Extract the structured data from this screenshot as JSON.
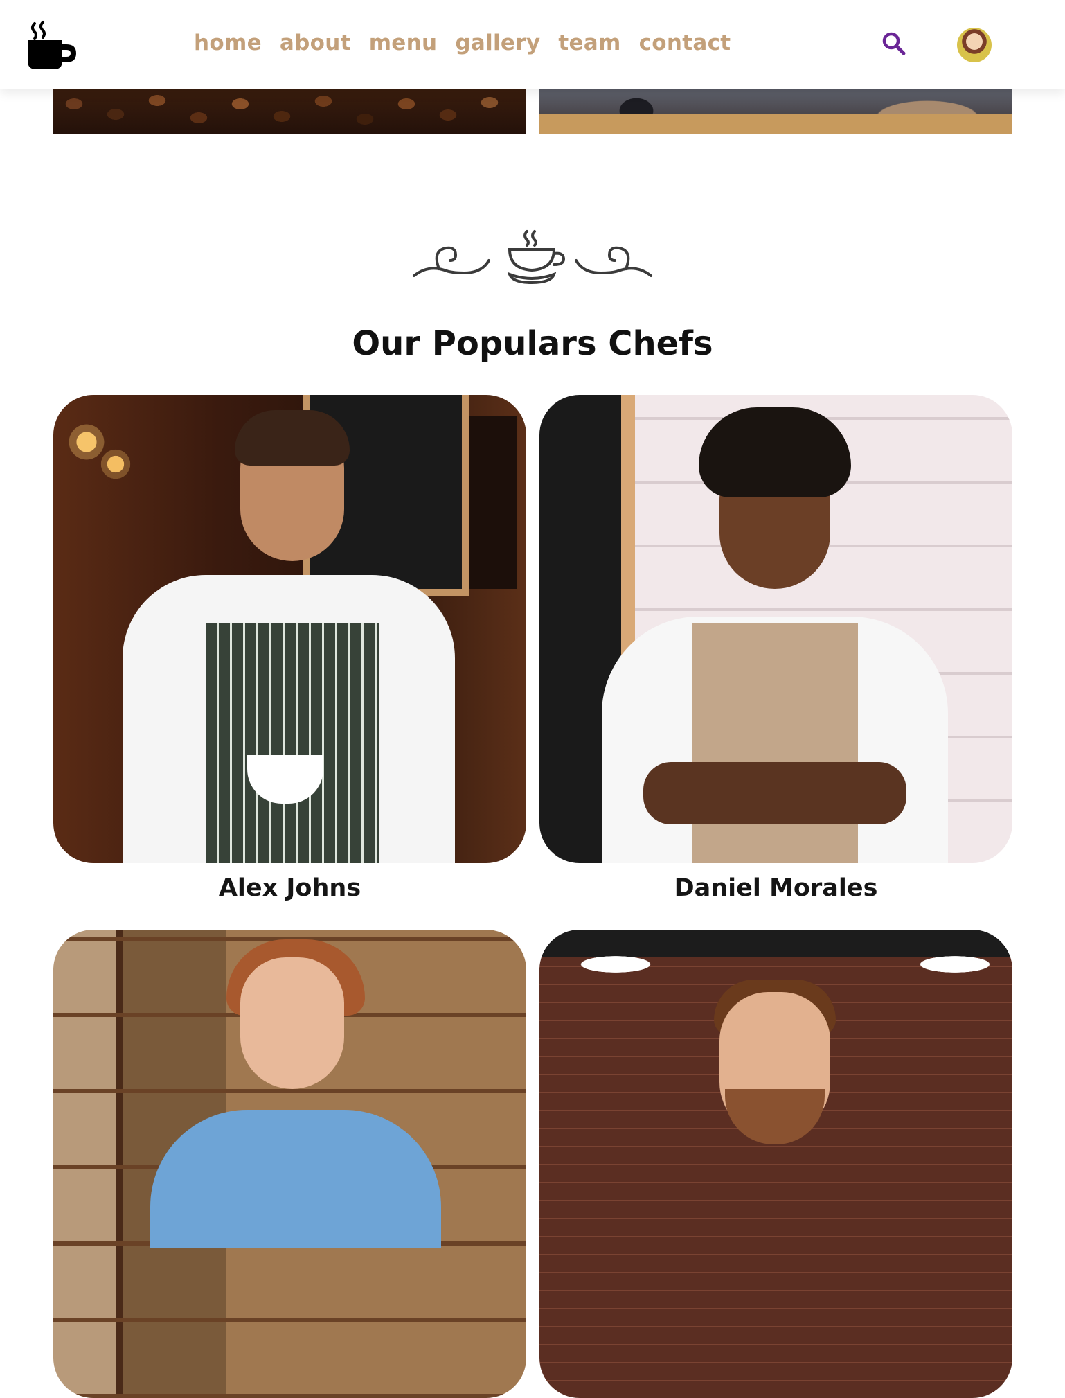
{
  "nav": {
    "items": [
      {
        "label": "home"
      },
      {
        "label": "about"
      },
      {
        "label": "menu"
      },
      {
        "label": "gallery"
      },
      {
        "label": "team"
      },
      {
        "label": "contact"
      }
    ]
  },
  "icons": {
    "logo": "coffee-mug-icon",
    "search": "search-icon",
    "ornament": "coffee-cup-ornament-icon"
  },
  "colors": {
    "nav_text": "#c3a07a",
    "search_icon": "#6a2596",
    "title_text": "#111111"
  },
  "section": {
    "title": "Our Populars Chefs"
  },
  "chefs": [
    {
      "name": "Alex Johns"
    },
    {
      "name": "Daniel Morales"
    },
    {
      "name": ""
    },
    {
      "name": ""
    }
  ]
}
